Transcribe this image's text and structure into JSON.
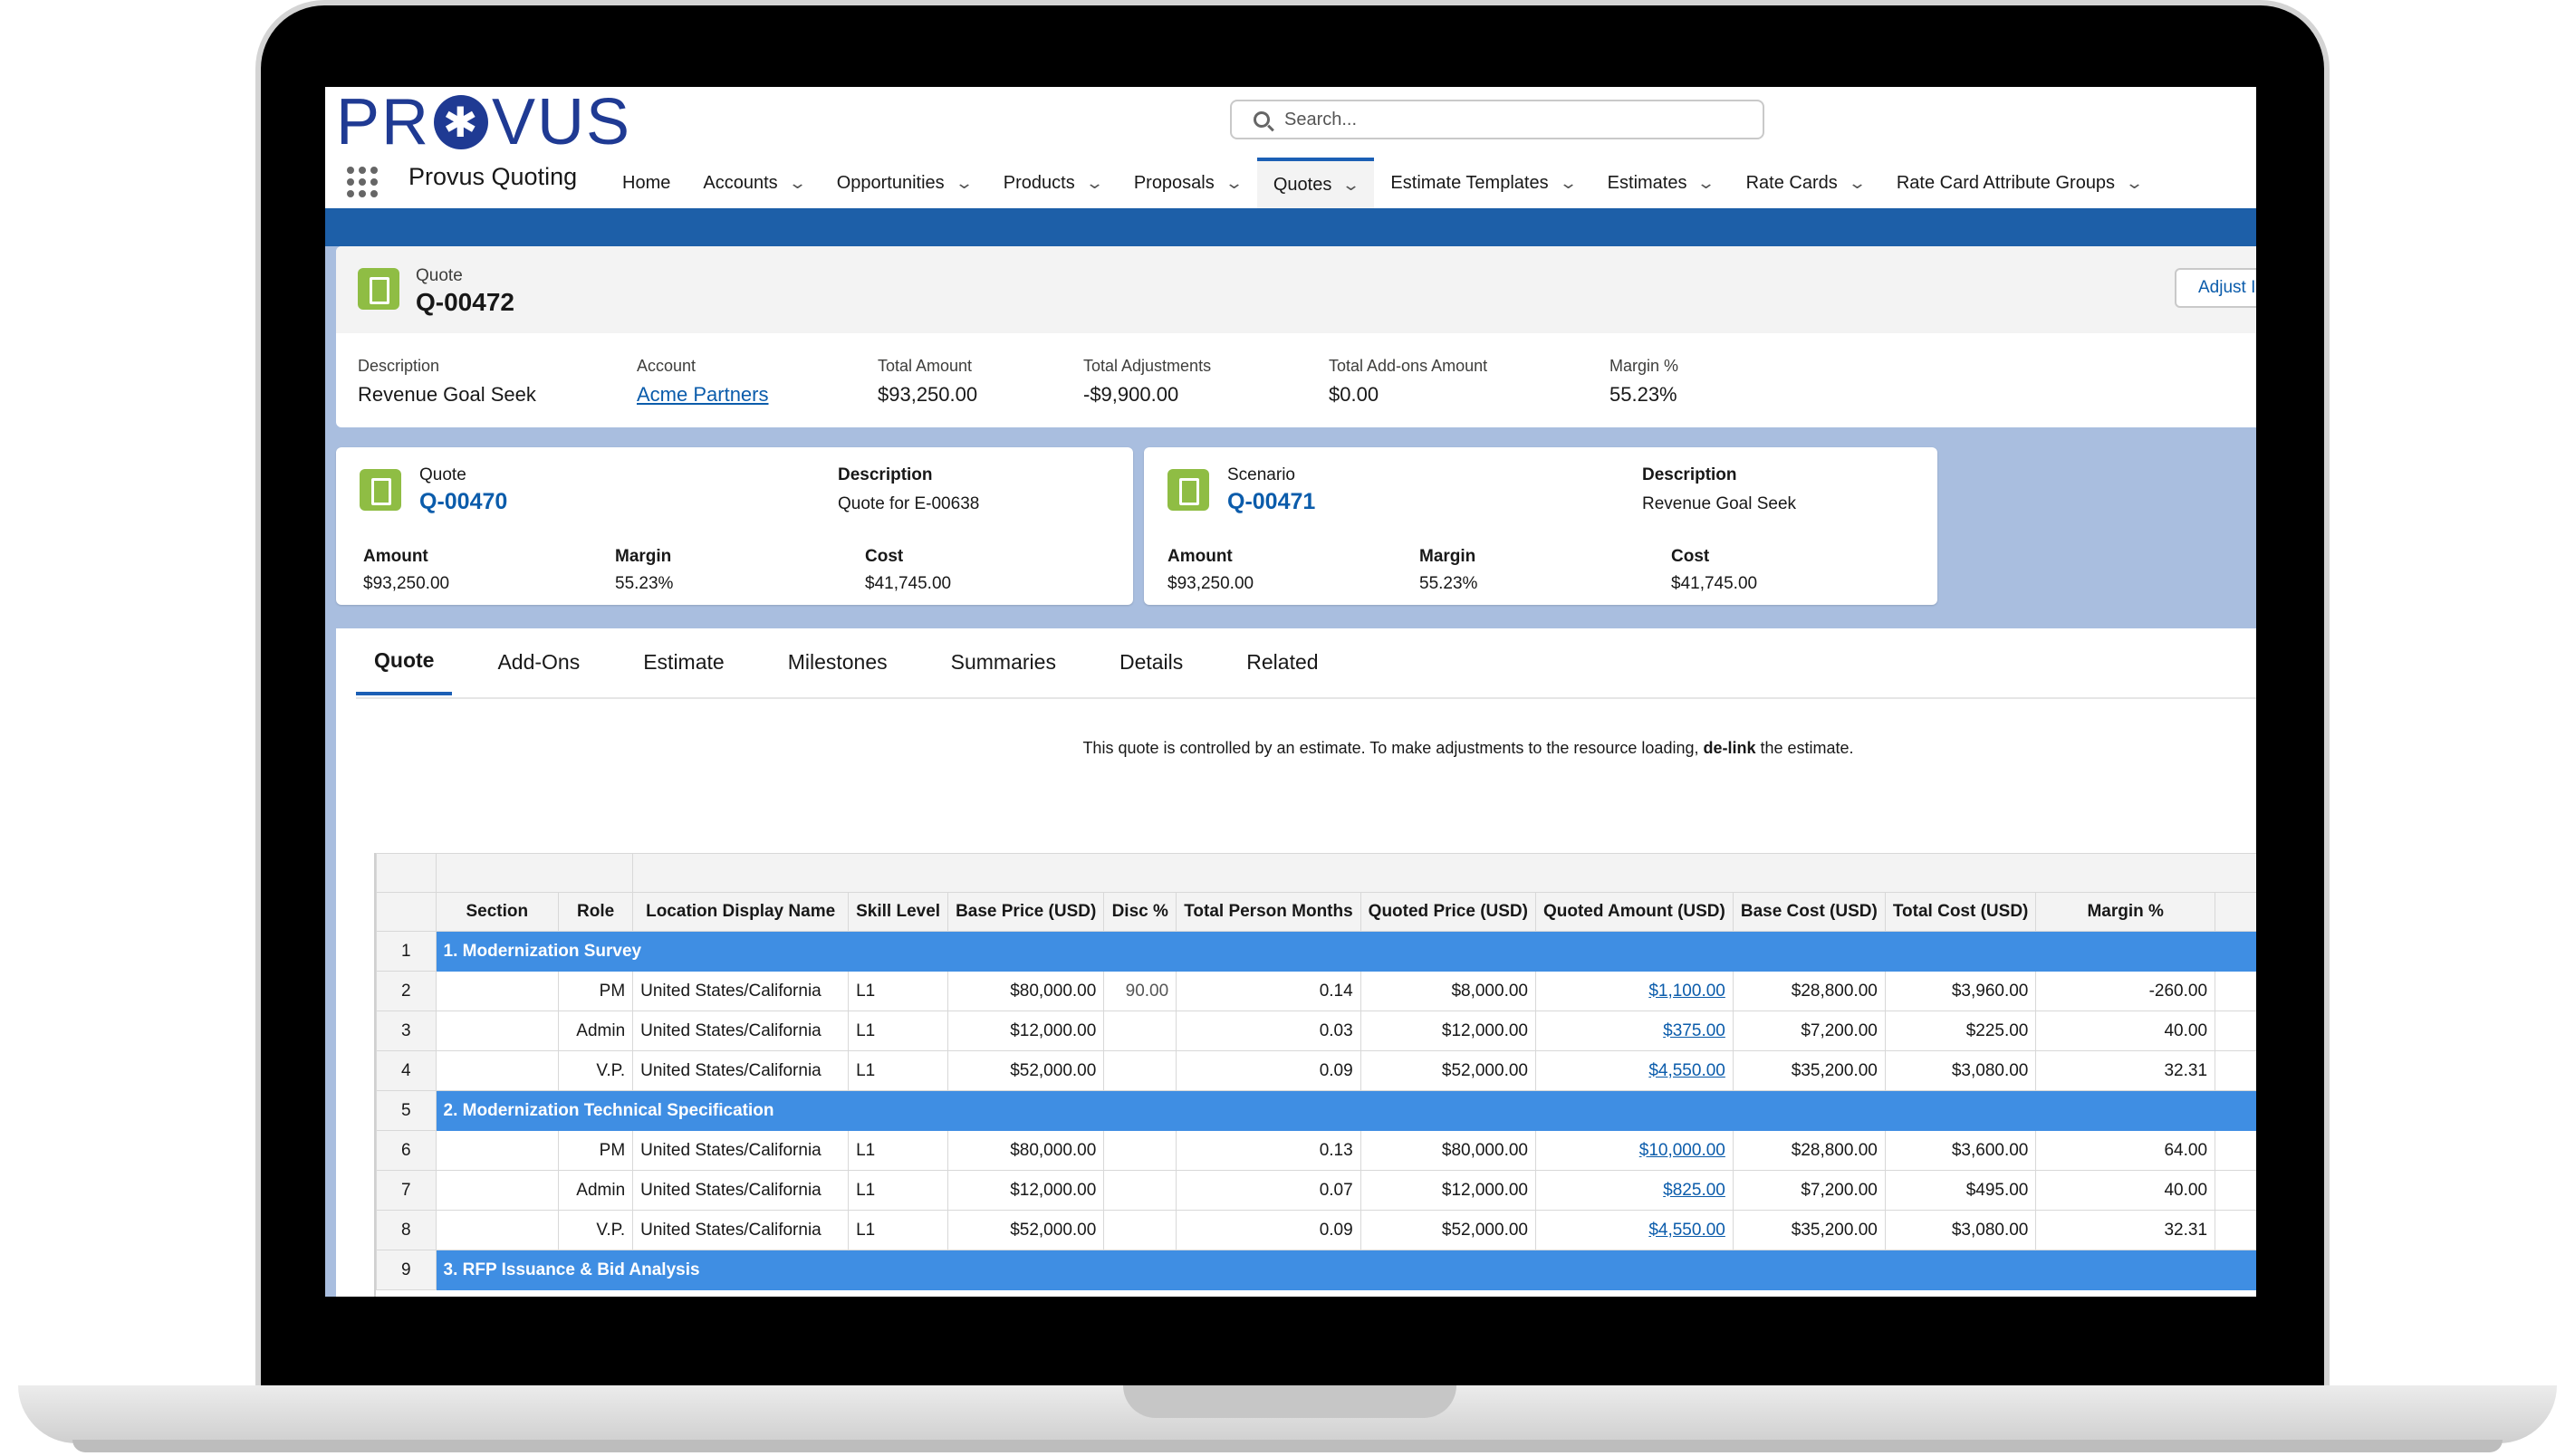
{
  "header": {
    "logo_text": "PROVUS",
    "app_name": "Provus Quoting",
    "search_placeholder": "Search..."
  },
  "nav": [
    {
      "label": "Home",
      "has_menu": false,
      "active": false
    },
    {
      "label": "Accounts",
      "has_menu": true,
      "active": false
    },
    {
      "label": "Opportunities",
      "has_menu": true,
      "active": false
    },
    {
      "label": "Products",
      "has_menu": true,
      "active": false
    },
    {
      "label": "Proposals",
      "has_menu": true,
      "active": false
    },
    {
      "label": "Quotes",
      "has_menu": true,
      "active": true
    },
    {
      "label": "Estimate Templates",
      "has_menu": true,
      "active": false
    },
    {
      "label": "Estimates",
      "has_menu": true,
      "active": false
    },
    {
      "label": "Rate Cards",
      "has_menu": true,
      "active": false
    },
    {
      "label": "Rate Card Attribute Groups",
      "has_menu": true,
      "active": false
    }
  ],
  "record": {
    "type_label": "Quote",
    "title": "Q-00472",
    "adjust_button": "Adjust I",
    "fields": [
      {
        "label": "Description",
        "value": "Revenue Goal Seek",
        "link": false
      },
      {
        "label": "Account",
        "value": "Acme Partners",
        "link": true
      },
      {
        "label": "Total Amount",
        "value": "$93,250.00",
        "link": false
      },
      {
        "label": "Total Adjustments",
        "value": "-$9,900.00",
        "link": false
      },
      {
        "label": "Total Add-ons Amount",
        "value": "$0.00",
        "link": false
      },
      {
        "label": "Margin %",
        "value": "55.23%",
        "link": false
      }
    ]
  },
  "compare": {
    "quote": {
      "type_label": "Quote",
      "number": "Q-00470",
      "description_label": "Description",
      "description": "Quote for E-00638",
      "amount_label": "Amount",
      "amount": "$93,250.00",
      "margin_label": "Margin",
      "margin": "55.23%",
      "cost_label": "Cost",
      "cost": "$41,745.00"
    },
    "scenario": {
      "type_label": "Scenario",
      "number": "Q-00471",
      "description_label": "Description",
      "description": "Revenue Goal Seek",
      "amount_label": "Amount",
      "amount": "$93,250.00",
      "margin_label": "Margin",
      "margin": "55.23%",
      "cost_label": "Cost",
      "cost": "$41,745.00"
    }
  },
  "tabs": [
    {
      "label": "Quote",
      "active": true
    },
    {
      "label": "Add-Ons",
      "active": false
    },
    {
      "label": "Estimate",
      "active": false
    },
    {
      "label": "Milestones",
      "active": false
    },
    {
      "label": "Summaries",
      "active": false
    },
    {
      "label": "Details",
      "active": false
    },
    {
      "label": "Related",
      "active": false
    }
  ],
  "notice": {
    "before": "This quote is controlled by an estimate. To make adjustments to the resource loading, ",
    "bold": "de-link",
    "after": " the estimate."
  },
  "grid": {
    "columns": [
      "Section",
      "Role",
      "Location Display Name",
      "Skill Level",
      "Base Price (USD)",
      "Disc %",
      "Total Person Months",
      "Quoted Price (USD)",
      "Quoted Amount (USD)",
      "Base Cost (USD)",
      "Total Cost (USD)",
      "Margin %"
    ],
    "rows": [
      {
        "n": "1",
        "section": "1. Modernization Survey"
      },
      {
        "n": "2",
        "role": "PM",
        "location": "United States/California",
        "skill": "L1",
        "base_price": "$80,000.00",
        "disc": "90.00",
        "months": "0.14",
        "quoted_price": "$8,000.00",
        "quoted_amount": "$1,100.00",
        "base_cost": "$28,800.00",
        "total_cost": "$3,960.00",
        "margin": "-260.00"
      },
      {
        "n": "3",
        "role": "Admin",
        "location": "United States/California",
        "skill": "L1",
        "base_price": "$12,000.00",
        "disc": "",
        "months": "0.03",
        "quoted_price": "$12,000.00",
        "quoted_amount": "$375.00",
        "base_cost": "$7,200.00",
        "total_cost": "$225.00",
        "margin": "40.00"
      },
      {
        "n": "4",
        "role": "V.P.",
        "location": "United States/California",
        "skill": "L1",
        "base_price": "$52,000.00",
        "disc": "",
        "months": "0.09",
        "quoted_price": "$52,000.00",
        "quoted_amount": "$4,550.00",
        "base_cost": "$35,200.00",
        "total_cost": "$3,080.00",
        "margin": "32.31"
      },
      {
        "n": "5",
        "section": "2. Modernization Technical Specification"
      },
      {
        "n": "6",
        "role": "PM",
        "location": "United States/California",
        "skill": "L1",
        "base_price": "$80,000.00",
        "disc": "",
        "months": "0.13",
        "quoted_price": "$80,000.00",
        "quoted_amount": "$10,000.00",
        "base_cost": "$28,800.00",
        "total_cost": "$3,600.00",
        "margin": "64.00"
      },
      {
        "n": "7",
        "role": "Admin",
        "location": "United States/California",
        "skill": "L1",
        "base_price": "$12,000.00",
        "disc": "",
        "months": "0.07",
        "quoted_price": "$12,000.00",
        "quoted_amount": "$825.00",
        "base_cost": "$7,200.00",
        "total_cost": "$495.00",
        "margin": "40.00"
      },
      {
        "n": "8",
        "role": "V.P.",
        "location": "United States/California",
        "skill": "L1",
        "base_price": "$52,000.00",
        "disc": "",
        "months": "0.09",
        "quoted_price": "$52,000.00",
        "quoted_amount": "$4,550.00",
        "base_cost": "$35,200.00",
        "total_cost": "$3,080.00",
        "margin": "32.31"
      },
      {
        "n": "9",
        "section": "3. RFP Issuance & Bid Analysis"
      }
    ]
  }
}
